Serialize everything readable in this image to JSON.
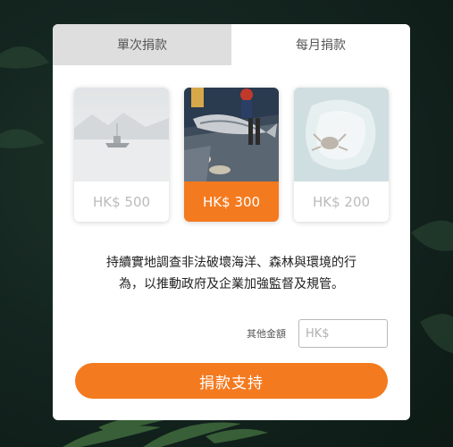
{
  "tabs": [
    {
      "label": "單次捐款",
      "active": false
    },
    {
      "label": "每月捐款",
      "active": true
    }
  ],
  "options": [
    {
      "price": "HK$ 500",
      "image": "arctic-boat",
      "selected": false
    },
    {
      "price": "HK$ 300",
      "image": "tuna-on-deck",
      "selected": true
    },
    {
      "price": "HK$ 200",
      "image": "plastic-bag-crab",
      "selected": false
    }
  ],
  "description": {
    "line1": "持續實地調查非法破壞海洋、森林與環境的行",
    "line2": "為，以推動政府及企業加強監督及規管。"
  },
  "other_amount": {
    "label": "其他金額",
    "placeholder": "HK$",
    "value": ""
  },
  "donate_button": {
    "label": "捐款支持"
  },
  "colors": {
    "accent": "#f47a1f",
    "inactive_tab": "#dedede",
    "background": "#142520"
  }
}
